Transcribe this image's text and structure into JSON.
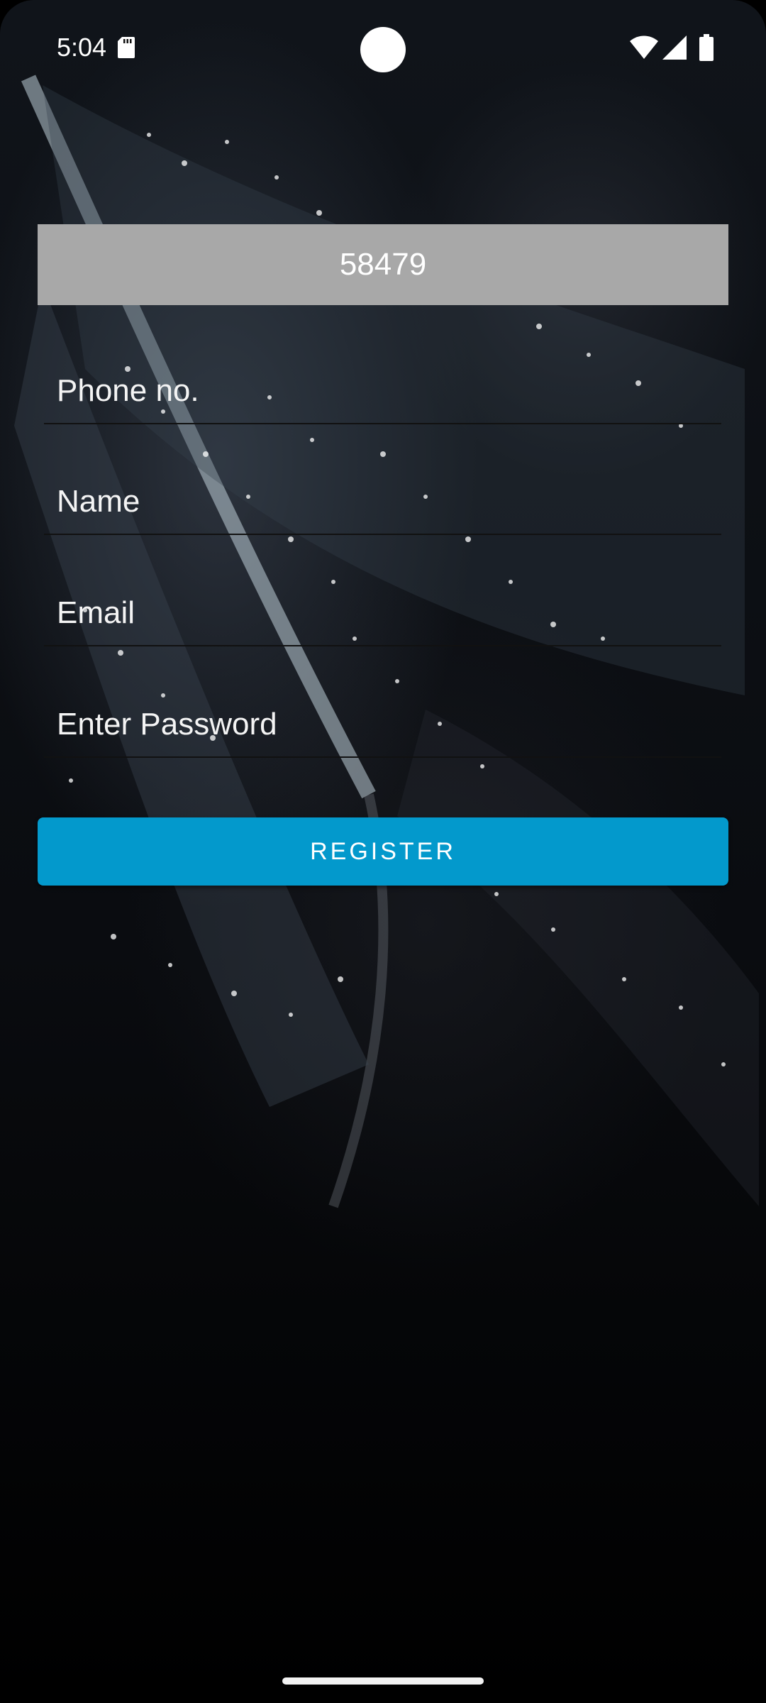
{
  "status_bar": {
    "time": "5:04",
    "icons": [
      "sd-card-icon",
      "wifi-icon",
      "signal-icon",
      "battery-icon"
    ]
  },
  "code_display": {
    "value": "58479"
  },
  "form": {
    "phone_placeholder": "Phone no.",
    "name_placeholder": "Name",
    "email_placeholder": "Email",
    "password_placeholder": "Enter Password",
    "register_label": "REGISTER"
  },
  "colors": {
    "accent": "#0399cc",
    "code_box": "#a8a8a8"
  }
}
